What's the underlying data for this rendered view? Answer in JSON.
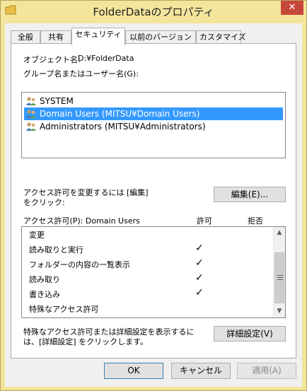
{
  "window": {
    "title": "FolderDataのプロパティ",
    "close_symbol": "✕"
  },
  "tabs": [
    {
      "label": "全般"
    },
    {
      "label": "共有"
    },
    {
      "label": "セキュリティ"
    },
    {
      "label": "以前のバージョン"
    },
    {
      "label": "カスタマイズ"
    }
  ],
  "active_tab": "セキュリティ",
  "object": {
    "label": "オブジェクト名:",
    "value": "D:¥FolderData"
  },
  "groups": {
    "label": "グループ名またはユーザー名(G):",
    "items": [
      {
        "name": "SYSTEM",
        "icon": "user-group-icon",
        "selected": false
      },
      {
        "name": "Domain Users (MITSU¥Domain Users)",
        "icon": "user-group-icon",
        "selected": true
      },
      {
        "name": "Administrators (MITSU¥Administrators)",
        "icon": "user-group-icon",
        "selected": false
      }
    ]
  },
  "edit": {
    "hint_line1": "アクセス許可を変更するには [編集]",
    "hint_line2": "をクリック:",
    "button_label": "編集(E)..."
  },
  "permissions": {
    "label": "アクセス許可(P): Domain Users",
    "allow_header": "許可",
    "deny_header": "拒否",
    "rows": [
      {
        "name": "変更",
        "allow": "",
        "deny": ""
      },
      {
        "name": "読み取りと実行",
        "allow": "✓",
        "deny": ""
      },
      {
        "name": "フォルダーの内容の一覧表示",
        "allow": "✓",
        "deny": ""
      },
      {
        "name": "読み取り",
        "allow": "✓",
        "deny": ""
      },
      {
        "name": "書き込み",
        "allow": "✓",
        "deny": ""
      },
      {
        "name": "特殊なアクセス許可",
        "allow": "",
        "deny": ""
      }
    ]
  },
  "advanced": {
    "hint_line1": "特殊なアクセス許可または詳細設定を表示するに",
    "hint_line2": "は、[詳細設定] をクリックします。",
    "button_label": "詳細設定(V)"
  },
  "footer": {
    "ok_label": "OK",
    "cancel_label": "キャンセル",
    "apply_label": "適用(A)"
  },
  "colors": {
    "title_bar": "#f3e59c",
    "close_button": "#c7463a",
    "selection": "#3399ff"
  }
}
